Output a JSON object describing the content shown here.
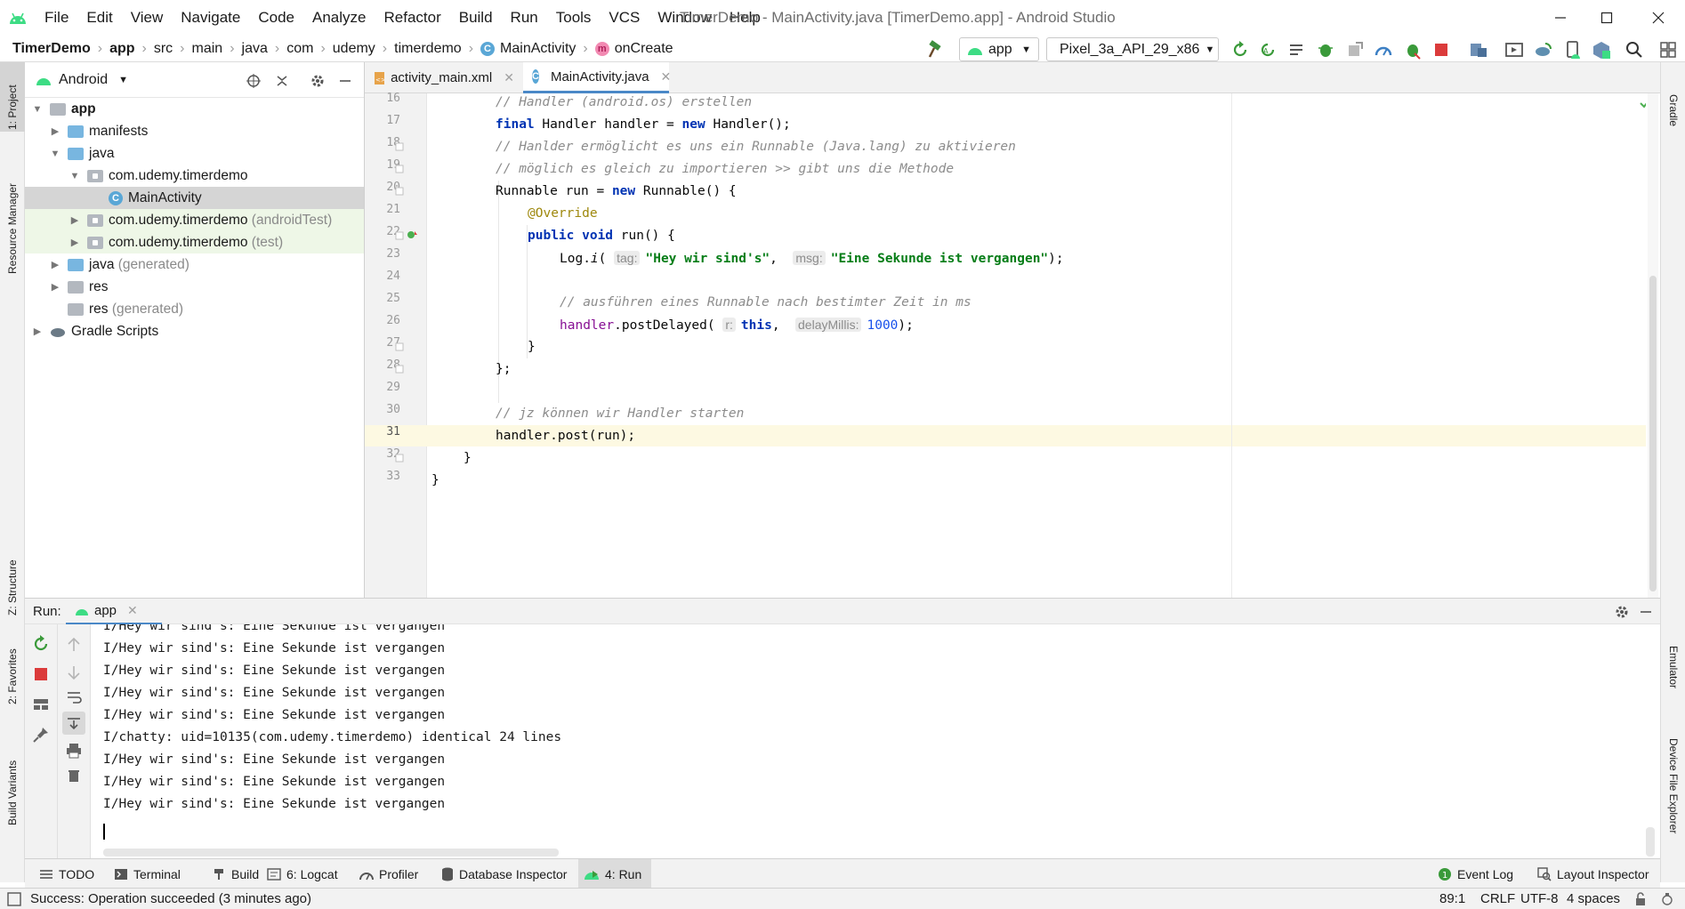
{
  "window": {
    "title": "TimerDemo - MainActivity.java [TimerDemo.app] - Android Studio",
    "controls": [
      "minimize",
      "maximize",
      "close"
    ]
  },
  "menu": [
    "File",
    "Edit",
    "View",
    "Navigate",
    "Code",
    "Analyze",
    "Refactor",
    "Build",
    "Run",
    "Tools",
    "VCS",
    "Window",
    "Help"
  ],
  "breadcrumb": [
    "TimerDemo",
    "app",
    "src",
    "main",
    "java",
    "com",
    "udemy",
    "timerdemo",
    "MainActivity",
    "onCreate"
  ],
  "toolbar": {
    "run_config": "app",
    "device": "Pixel_3a_API_29_x86"
  },
  "project": {
    "view_mode": "Android",
    "tree": [
      {
        "label": "app",
        "extra": ""
      },
      {
        "label": "manifests",
        "extra": ""
      },
      {
        "label": "java",
        "extra": ""
      },
      {
        "label": "com.udemy.timerdemo",
        "extra": ""
      },
      {
        "label": "MainActivity",
        "extra": ""
      },
      {
        "label": "com.udemy.timerdemo",
        "extra": "(androidTest)"
      },
      {
        "label": "com.udemy.timerdemo",
        "extra": "(test)"
      },
      {
        "label": "java",
        "extra": "(generated)"
      },
      {
        "label": "res",
        "extra": ""
      },
      {
        "label": "res",
        "extra": "(generated)"
      },
      {
        "label": "Gradle Scripts",
        "extra": ""
      }
    ]
  },
  "editor": {
    "tabs": [
      "activity_main.xml",
      "MainActivity.java"
    ],
    "active_tab": "MainActivity.java",
    "line_numbers": [
      "16",
      "17",
      "18",
      "19",
      "20",
      "21",
      "22",
      "23",
      "24",
      "25",
      "26",
      "27",
      "28",
      "29",
      "30",
      "31",
      "32",
      "33"
    ],
    "code": {
      "l16": "// Handler (android.os) erstellen",
      "l17_kw": "final",
      "l17_a": " Handler handler = ",
      "l17_kw2": "new",
      "l17_b": " Handler();",
      "l18": "// Hanlder ermöglicht es uns ein Runnable (Java.lang) zu aktivieren",
      "l19": "// möglich es gleich zu importieren >> gibt uns die Methode",
      "l20_a": "Runnable run = ",
      "l20_kw": "new",
      "l20_b": " Runnable() {",
      "l21": "@Override",
      "l22_kw": "public void",
      "l22_b": " run() {",
      "l23_a": "Log.",
      "l23_fn": "i",
      "l23_b": "( ",
      "l23_hint1": "tag:",
      "l23_s1": "\"Hey wir sind's\"",
      "l23_c": ",  ",
      "l23_hint2": "msg:",
      "l23_s2": "\"Eine Sekunde ist vergangen\"",
      "l23_d": ");",
      "l25": "// ausführen eines Runnable nach bestimter Zeit in ms",
      "l26_a": "handler",
      "l26_b": ".postDelayed( ",
      "l26_hint1": "r:",
      "l26_kw": "this",
      "l26_c": ",  ",
      "l26_hint2": "delayMillis:",
      "l26_num": "1000",
      "l26_d": ");",
      "l27": "}",
      "l28": "};",
      "l30": "// jz können wir Handler starten",
      "l31": "handler.post(run);",
      "l32": "}",
      "l33": "}"
    }
  },
  "run_panel": {
    "label": "Run:",
    "tab": "app",
    "lines": [
      "I/Hey wir sind's: Eine Sekunde ist vergangen",
      "I/Hey wir sind's: Eine Sekunde ist vergangen",
      "I/Hey wir sind's: Eine Sekunde ist vergangen",
      "I/Hey wir sind's: Eine Sekunde ist vergangen",
      "I/Hey wir sind's: Eine Sekunde ist vergangen",
      "I/chatty: uid=10135(com.udemy.timerdemo) identical 24 lines",
      "I/Hey wir sind's: Eine Sekunde ist vergangen",
      "I/Hey wir sind's: Eine Sekunde ist vergangen",
      "I/Hey wir sind's: Eine Sekunde ist vergangen"
    ]
  },
  "side_tabs": {
    "left": [
      "1: Project",
      "Resource Manager",
      "Z: Structure",
      "2: Favorites",
      "Build Variants"
    ],
    "right": [
      "Gradle",
      "Emulator",
      "Device File Explorer"
    ]
  },
  "bottom_tabs": [
    "TODO",
    "Terminal",
    "Build",
    "6: Logcat",
    "Profiler",
    "Database Inspector",
    "4: Run"
  ],
  "bottom_right_tabs": [
    "Event Log",
    "Layout Inspector"
  ],
  "status": {
    "message": "Success: Operation succeeded (3 minutes ago)",
    "position": "89:1",
    "line_sep": "CRLF",
    "encoding": "UTF-8",
    "indent": "4 spaces"
  },
  "colors": {
    "accent": "#4a88c7",
    "android_green": "#3ddc84",
    "keyword": "#0033b3",
    "string": "#067d17",
    "comment": "#8c8c8c",
    "stop_red": "#db3b3b",
    "current_line": "#fdf9e2"
  }
}
